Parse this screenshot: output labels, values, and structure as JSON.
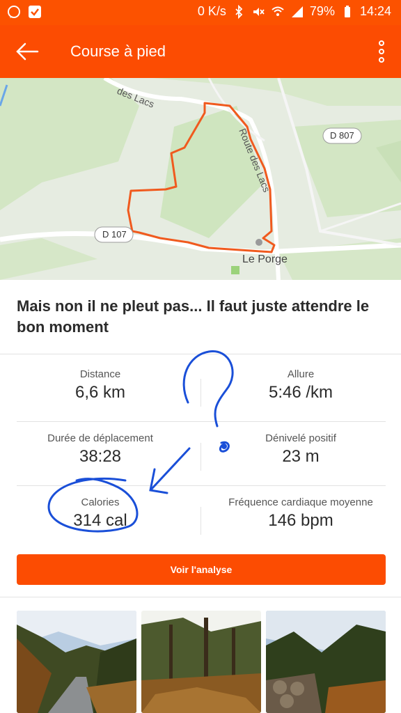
{
  "status_bar": {
    "network_speed": "0 K/s",
    "battery": "79%",
    "time": "14:24"
  },
  "app_bar": {
    "title": "Course à pied"
  },
  "map": {
    "road_labels": [
      "des Lacs",
      "Route des Lacs",
      "D 807",
      "D 107",
      "Le Porge"
    ]
  },
  "activity": {
    "title": "Mais non il ne pleut pas... Il faut juste attendre le bon moment"
  },
  "stats": [
    {
      "label": "Distance",
      "value": "6,6 km"
    },
    {
      "label": "Allure",
      "value": "5:46 /km"
    },
    {
      "label": "Durée de déplacement",
      "value": "38:28"
    },
    {
      "label": "Dénivelé positif",
      "value": "23 m"
    },
    {
      "label": "Calories",
      "value": "314 cal"
    },
    {
      "label": "Fréquence cardiaque moyenne",
      "value": "146 bpm"
    }
  ],
  "actions": {
    "analyse_label": "Voir l'analyse"
  },
  "colors": {
    "brand": "#fc4c02",
    "route": "#f05a1e",
    "annotation": "#1a4fd8"
  }
}
